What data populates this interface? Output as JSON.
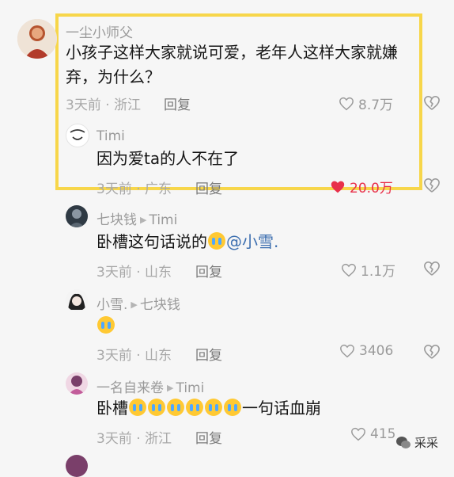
{
  "comments": [
    {
      "user": "一尘小师父",
      "text": "小孩子这样大家就说可爱，老年人这样大家就嫌弃，为什么？",
      "meta": "3天前 · 浙江",
      "reply": "回复",
      "likes": "8.7万"
    },
    {
      "user": "Timi",
      "text": "因为爱ta的人不在了",
      "meta": "3天前 · 广东",
      "reply": "回复",
      "likes": "20.0万",
      "liked": true
    },
    {
      "user": "七块钱",
      "reply_to": "Timi",
      "text_prefix": "卧槽这句话说的",
      "mention": "@小雪.",
      "meta": "3天前 · 山东",
      "reply": "回复",
      "likes": "1.1万"
    },
    {
      "user": "小雪.",
      "reply_to": "七块钱",
      "meta": "3天前 · 山东",
      "reply": "回复",
      "likes": "3406"
    },
    {
      "user": "一名自来卷",
      "reply_to": "Timi",
      "text_prefix": "卧槽",
      "text_suffix": "一句话血崩",
      "meta": "3天前 · 浙江",
      "reply": "回复",
      "likes": "415"
    }
  ],
  "watermark": "采采",
  "icons": {
    "like": "heart-outline-icon",
    "liked": "heart-filled-icon",
    "dislike": "broken-heart-icon",
    "reply_arrow": "triangle-right-icon",
    "emoji": "crying-face-emoji"
  },
  "colors": {
    "highlight_border": "#f7d64a",
    "liked": "#e8304a",
    "mention": "#3d6fb0"
  }
}
